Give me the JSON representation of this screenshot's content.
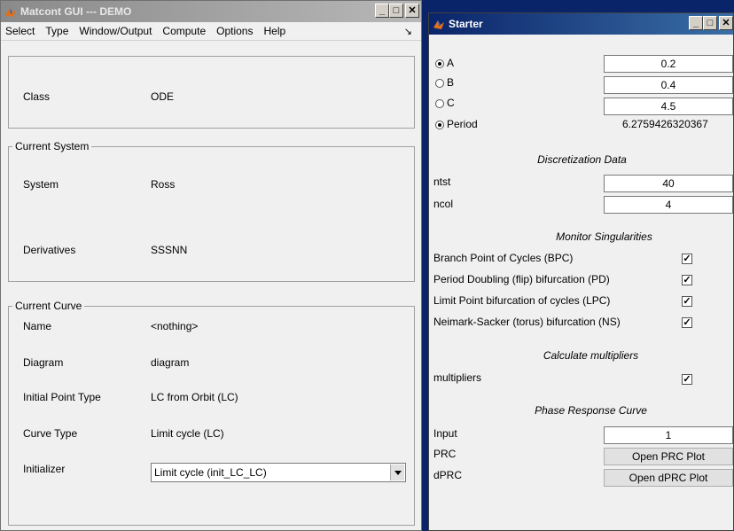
{
  "left_window": {
    "title": "Matcont GUI --- DEMO",
    "menu": [
      "Select",
      "Type",
      "Window/Output",
      "Compute",
      "Options",
      "Help"
    ],
    "menu_arrow": "↘",
    "class_label": "Class",
    "class_value": "ODE",
    "system_section": "Current System",
    "system_label": "System",
    "system_value": "Ross",
    "derivatives_label": "Derivatives",
    "derivatives_value": "SSSNN",
    "curve_section": "Current Curve",
    "name_label": "Name",
    "name_value": "<nothing>",
    "diagram_label": "Diagram",
    "diagram_value": "diagram",
    "ipt_label": "Initial Point Type",
    "ipt_value": "LC from Orbit (LC)",
    "curve_type_label": "Curve Type",
    "curve_type_value": "Limit cycle (LC)",
    "initializer_label": "Initializer",
    "initializer_value": "Limit cycle (init_LC_LC)"
  },
  "right_window": {
    "title": "Starter",
    "params": [
      {
        "name": "A",
        "value": "0.2",
        "selected": true
      },
      {
        "name": "B",
        "value": "0.4",
        "selected": false
      },
      {
        "name": "C",
        "value": "4.5",
        "selected": false
      }
    ],
    "period_label": "Period",
    "period_value": "6.2759426320367",
    "discretization_header": "Discretization Data",
    "ntst_label": "ntst",
    "ntst_value": "40",
    "ncol_label": "ncol",
    "ncol_value": "4",
    "monitor_header": "Monitor Singularities",
    "monitors": [
      {
        "label": "Branch Point of Cycles (BPC)",
        "checked": true
      },
      {
        "label": "Period Doubling (flip) bifurcation (PD)",
        "checked": true
      },
      {
        "label": "Limit Point bifurcation of cycles (LPC)",
        "checked": true
      },
      {
        "label": "Neimark-Sacker (torus) bifurcation (NS)",
        "checked": true
      }
    ],
    "multipliers_header": "Calculate multipliers",
    "multipliers_label": "multipliers",
    "prc_header": "Phase Response Curve",
    "input_label": "Input",
    "input_value": "1",
    "prc_label": "PRC",
    "prc_button": "Open PRC Plot",
    "dprc_label": "dPRC",
    "dprc_button": "Open dPRC Plot"
  },
  "colors": {
    "active_title": "#0a246a",
    "inactive_title": "#8a8a8a",
    "window_bg": "#f0f0f0"
  }
}
